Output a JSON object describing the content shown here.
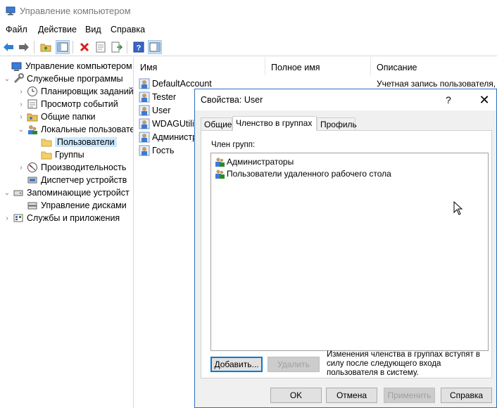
{
  "window": {
    "title": "Управление компьютером"
  },
  "menu": [
    "Файл",
    "Действие",
    "Вид",
    "Справка"
  ],
  "toolbar": {
    "icons": [
      "back-arrow-icon",
      "forward-arrow-icon",
      "up-folder-icon",
      "show-hide-tree-icon",
      "delete-icon",
      "properties-icon",
      "export-list-icon",
      "help-icon",
      "show-action-pane-icon"
    ]
  },
  "tree": {
    "items": [
      {
        "label": "Управление компьютером (л",
        "icon": "computer-management-icon",
        "chev": "",
        "level": 0
      },
      {
        "label": "Служебные программы",
        "icon": "tools-icon",
        "chev": "⌄",
        "level": 1
      },
      {
        "label": "Планировщик заданий",
        "icon": "clock-icon",
        "chev": "›",
        "level": 2
      },
      {
        "label": "Просмотр событий",
        "icon": "event-viewer-icon",
        "chev": "›",
        "level": 2
      },
      {
        "label": "Общие папки",
        "icon": "shared-folders-icon",
        "chev": "›",
        "level": 2
      },
      {
        "label": "Локальные пользовате",
        "icon": "local-users-icon",
        "chev": "⌄",
        "level": 2
      },
      {
        "label": "Пользователи",
        "icon": "folder-icon",
        "chev": "",
        "level": 3
      },
      {
        "label": "Группы",
        "icon": "folder-icon",
        "chev": "",
        "level": 3
      },
      {
        "label": "Производительность",
        "icon": "performance-icon",
        "chev": "›",
        "level": 2
      },
      {
        "label": "Диспетчер устройств",
        "icon": "device-manager-icon",
        "chev": "",
        "level": 2
      },
      {
        "label": "Запоминающие устройст",
        "icon": "storage-icon",
        "chev": "⌄",
        "level": 1
      },
      {
        "label": "Управление дисками",
        "icon": "disk-icon",
        "chev": "",
        "level": 2
      },
      {
        "label": "Службы и приложения",
        "icon": "services-icon",
        "chev": "›",
        "level": 1
      }
    ]
  },
  "list": {
    "columns": [
      "Имя",
      "Полное имя",
      "Описание"
    ],
    "rows": [
      {
        "name": "DefaultAccount",
        "description": "Учетная запись пользователя, у"
      },
      {
        "name": "Tester",
        "description": ""
      },
      {
        "name": "User",
        "description": ""
      },
      {
        "name": "WDAGUtilit",
        "description": ""
      },
      {
        "name": "Администр",
        "description": ""
      },
      {
        "name": "Гость",
        "description": ""
      }
    ]
  },
  "dialog": {
    "title": "Свойства: User",
    "help_glyph": "?",
    "close_glyph": "✕",
    "tabs": [
      "Общие",
      "Членство в группах",
      "Профиль"
    ],
    "active_tab": 1,
    "members_label": "Член групп:",
    "members": [
      "Администраторы",
      "Пользователи удаленного рабочего стола"
    ],
    "add_button": "Добавить...",
    "remove_button": "Удалить",
    "note": "Изменения членства в группах вступят в силу после следующего входа пользователя в систему.",
    "ok": "OK",
    "cancel": "Отмена",
    "apply": "Применить",
    "help": "Справка"
  },
  "colors": {
    "accent": "#0078d7",
    "selection": "#cce8ff",
    "dialog_bg": "#f0f0f0",
    "dialog_border": "#2b6fbf"
  }
}
